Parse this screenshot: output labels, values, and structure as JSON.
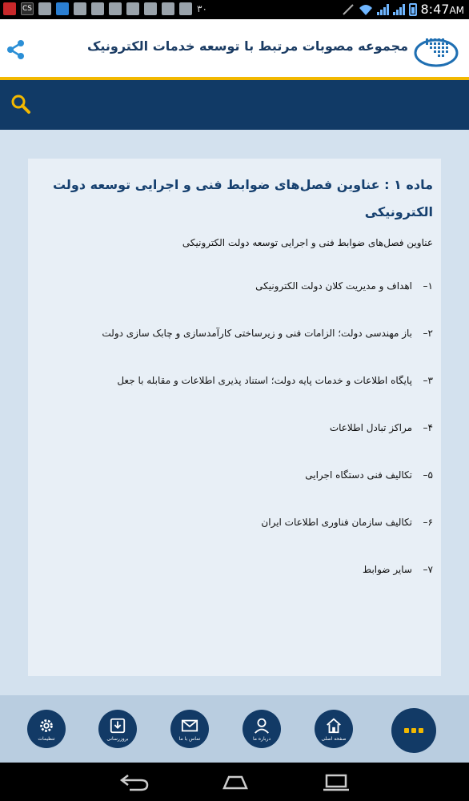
{
  "status_bar": {
    "left_icons": [
      "CS"
    ],
    "number": "۳۰",
    "time": "8:47",
    "am_pm": "AM"
  },
  "header": {
    "title": "مجموعه مصوبات مرتبط با توسعه خدمات الکترونیک"
  },
  "article": {
    "title": "ماده ۱ : عناوین فصل‌های ضوابط فنی و اجرایی توسعه دولت الکترونیکی",
    "subtitle": "عناوین فصل‌های ضوابط فنی و اجرایی توسعه دولت الکترونیکی",
    "items": [
      {
        "num": "۱–",
        "text": "اهداف و مدیریت کلان دولت الکترونیکی"
      },
      {
        "num": "۲–",
        "text": "باز مهندسی دولت؛ الزامات فنی و زیرساختی کارآمدسازی و چابک سازی دولت"
      },
      {
        "num": "۳–",
        "text": "پایگاه اطلاعات و خدمات پایه دولت؛ استناد پذیری اطلاعات و مقابله با جعل"
      },
      {
        "num": "۴–",
        "text": "مراکز تبادل اطلاعات"
      },
      {
        "num": "۵–",
        "text": "تکالیف فنی دستگاه اجرایی"
      },
      {
        "num": "۶–",
        "text": "تکالیف سازمان فناوری اطلاعات ایران"
      },
      {
        "num": "۷–",
        "text": "سایر ضوابط"
      }
    ]
  },
  "bottom_nav": {
    "settings": "تنظیمات",
    "update": "بروزرسانی",
    "contact": "تماس با ما",
    "about": "درباره ما",
    "home": "صفحه اصلی"
  },
  "colors": {
    "header_bg": "#ffffff",
    "accent_yellow": "#f2b800",
    "navy": "#113a66",
    "page_bg": "#d3e1ee",
    "card_bg": "#e8eff6",
    "title_blue": "#16406f"
  },
  "icons": [
    "share-icon",
    "logo-icon",
    "search-icon",
    "gear-icon",
    "download-icon",
    "mail-icon",
    "user-icon",
    "home-icon",
    "more-icon",
    "back-icon",
    "home-nav-icon",
    "recents-icon"
  ]
}
